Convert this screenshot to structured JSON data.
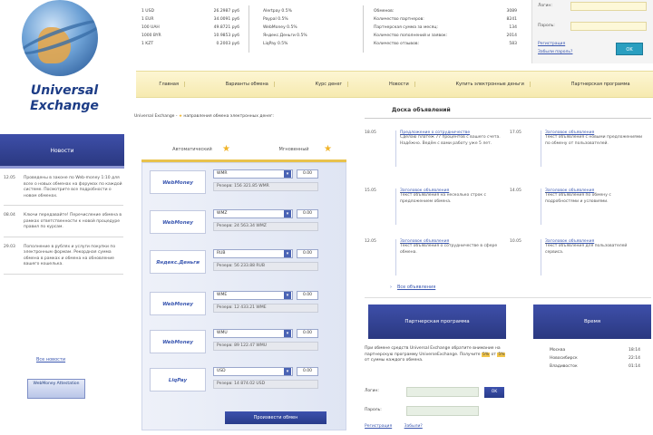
{
  "logo": {
    "name_line1": "Universal",
    "name_line2": "Exchange"
  },
  "rates": [
    [
      "1 USD",
      "26.2987 руб"
    ],
    [
      "1 EUR",
      "34.0091 руб"
    ],
    [
      "100 UAH",
      "49.8721 руб"
    ],
    [
      "1000 BYR",
      "10.9853 руб"
    ],
    [
      "1 KZT",
      "0.2003 руб"
    ]
  ],
  "fees": [
    "Alertpay 0.5%",
    "Paypal 0.5%",
    "WebMoney 0.5%",
    "Яндекс.Деньги 0.5%",
    "LiqPay 0.5%"
  ],
  "stats": [
    [
      "Обменов:",
      "3089"
    ],
    [
      "Количество партнеров:",
      "8241"
    ],
    [
      "Партнерская сумма за месяц:",
      "134"
    ],
    [
      "Количество пополнений и заявок:",
      "2014"
    ],
    [
      "Количество отзывов:",
      "583"
    ]
  ],
  "login": {
    "login_label": "Логин:",
    "password_label": "Пароль:",
    "link_register": "Регистрация",
    "link_forgot": "Забыли пароль?",
    "ok_button": "OK"
  },
  "nav": [
    "Главная",
    "Варианты обмена",
    "Курс денег",
    "Новости",
    "Купить электронные деньги",
    "Партнерская программа"
  ],
  "news": {
    "header": "Новости",
    "items": [
      {
        "date": "12.05",
        "text": "Проведены в законе по Web-money 1:10 для всех о новых обменах на форумах по каждой системе. Посмотрите все подробности о новом обменах."
      },
      {
        "date": "08.04",
        "text": "Ключи передавайте! Перечисление обмена в рамках ответственности к новой процедуре правил по курсам."
      },
      {
        "date": "29.03",
        "text": "Пополнение в рублях и услуги покупки по электронным формам. Рекордная сумма обмена в рамках и обмена на обновление вашего кошелька."
      }
    ],
    "all_link": "Все новости",
    "badge": "WebMoney Attestation"
  },
  "exchange": {
    "intro": "Universal Exchange - ",
    "intro_tail": " направления обмена электронных денег:",
    "tab_auto": "Автоматический",
    "tab_manual": "Мгновенный",
    "rows": [
      {
        "logo": "WebMoney",
        "select": "WMR",
        "amount": "0.00",
        "note": "Резерв: 156 321.85 WMR"
      },
      {
        "logo": "WebMoney",
        "select": "WMZ",
        "amount": "0.00",
        "note": "Резерв: 24 563.34 WMZ"
      },
      {
        "logo": "Яндекс.Деньги",
        "select": "RUB",
        "amount": "0.00",
        "note": "Резерв: 56 233.88 RUB"
      },
      {
        "logo": "WebMoney",
        "select": "WME",
        "amount": "0.00",
        "note": "Резерв: 12 433.21 WME"
      },
      {
        "logo": "WebMoney",
        "select": "WMU",
        "amount": "0.00",
        "note": "Резерв: 89 122.47 WMU"
      },
      {
        "logo": "LiqPay",
        "select": "USD",
        "amount": "0.00",
        "note": "Резерв: 14 874.02 USD"
      }
    ],
    "submit": "Произвести обмен"
  },
  "announcements": {
    "title": "Доска объявлений",
    "items": [
      {
        "date": "18.05",
        "head": "Предложение о сотрудничестве",
        "text": "Сделаю платёж 77 процентов с вашего счета. Надёжно. Ведём с вами работу уже 5 лет."
      },
      {
        "date": "17.05",
        "head": "Заголовок объявления",
        "text": "Текст объявления с новыми предложениями по обмену от пользователей."
      },
      {
        "date": "15.05",
        "head": "Заголовок объявления",
        "text": "Текст объявления на несколько строк с предложением обмена."
      },
      {
        "date": "14.05",
        "head": "Заголовок объявления",
        "text": "Текст объявления по обмену с подробностями и условиями."
      },
      {
        "date": "12.05",
        "head": "Заголовок объявления",
        "text": "Текст объявления о сотрудничестве в сфере обмена."
      },
      {
        "date": "10.05",
        "head": "Заголовок объявления",
        "text": "Текст объявления для пользователей сервиса."
      }
    ],
    "all_link": "Все объявления"
  },
  "partner": {
    "header": "Партнерская программа",
    "text_a": "При обмене средств Universal Exchange обратите внимание на партнерскую программу UniverseExchange. Получите ",
    "hl1": "5%",
    "text_b": " от ",
    "hl2": "5%",
    "text_c": " от суммы каждого обмена.",
    "login_label": "Логин:",
    "password_label": "Пароль:",
    "ok": "OK",
    "link_reg": "Регистрация",
    "link_forgot": "Забыли?"
  },
  "info": {
    "header": "Время",
    "rows": [
      [
        "Москва",
        "18:14"
      ],
      [
        "Новосибирск",
        "22:14"
      ],
      [
        "Владивосток",
        "01:14"
      ]
    ]
  },
  "colors": {
    "accent": "#2a3880",
    "nav_bg": "#f6eab0",
    "link": "#3a57b0",
    "star": "#f0b42a"
  }
}
